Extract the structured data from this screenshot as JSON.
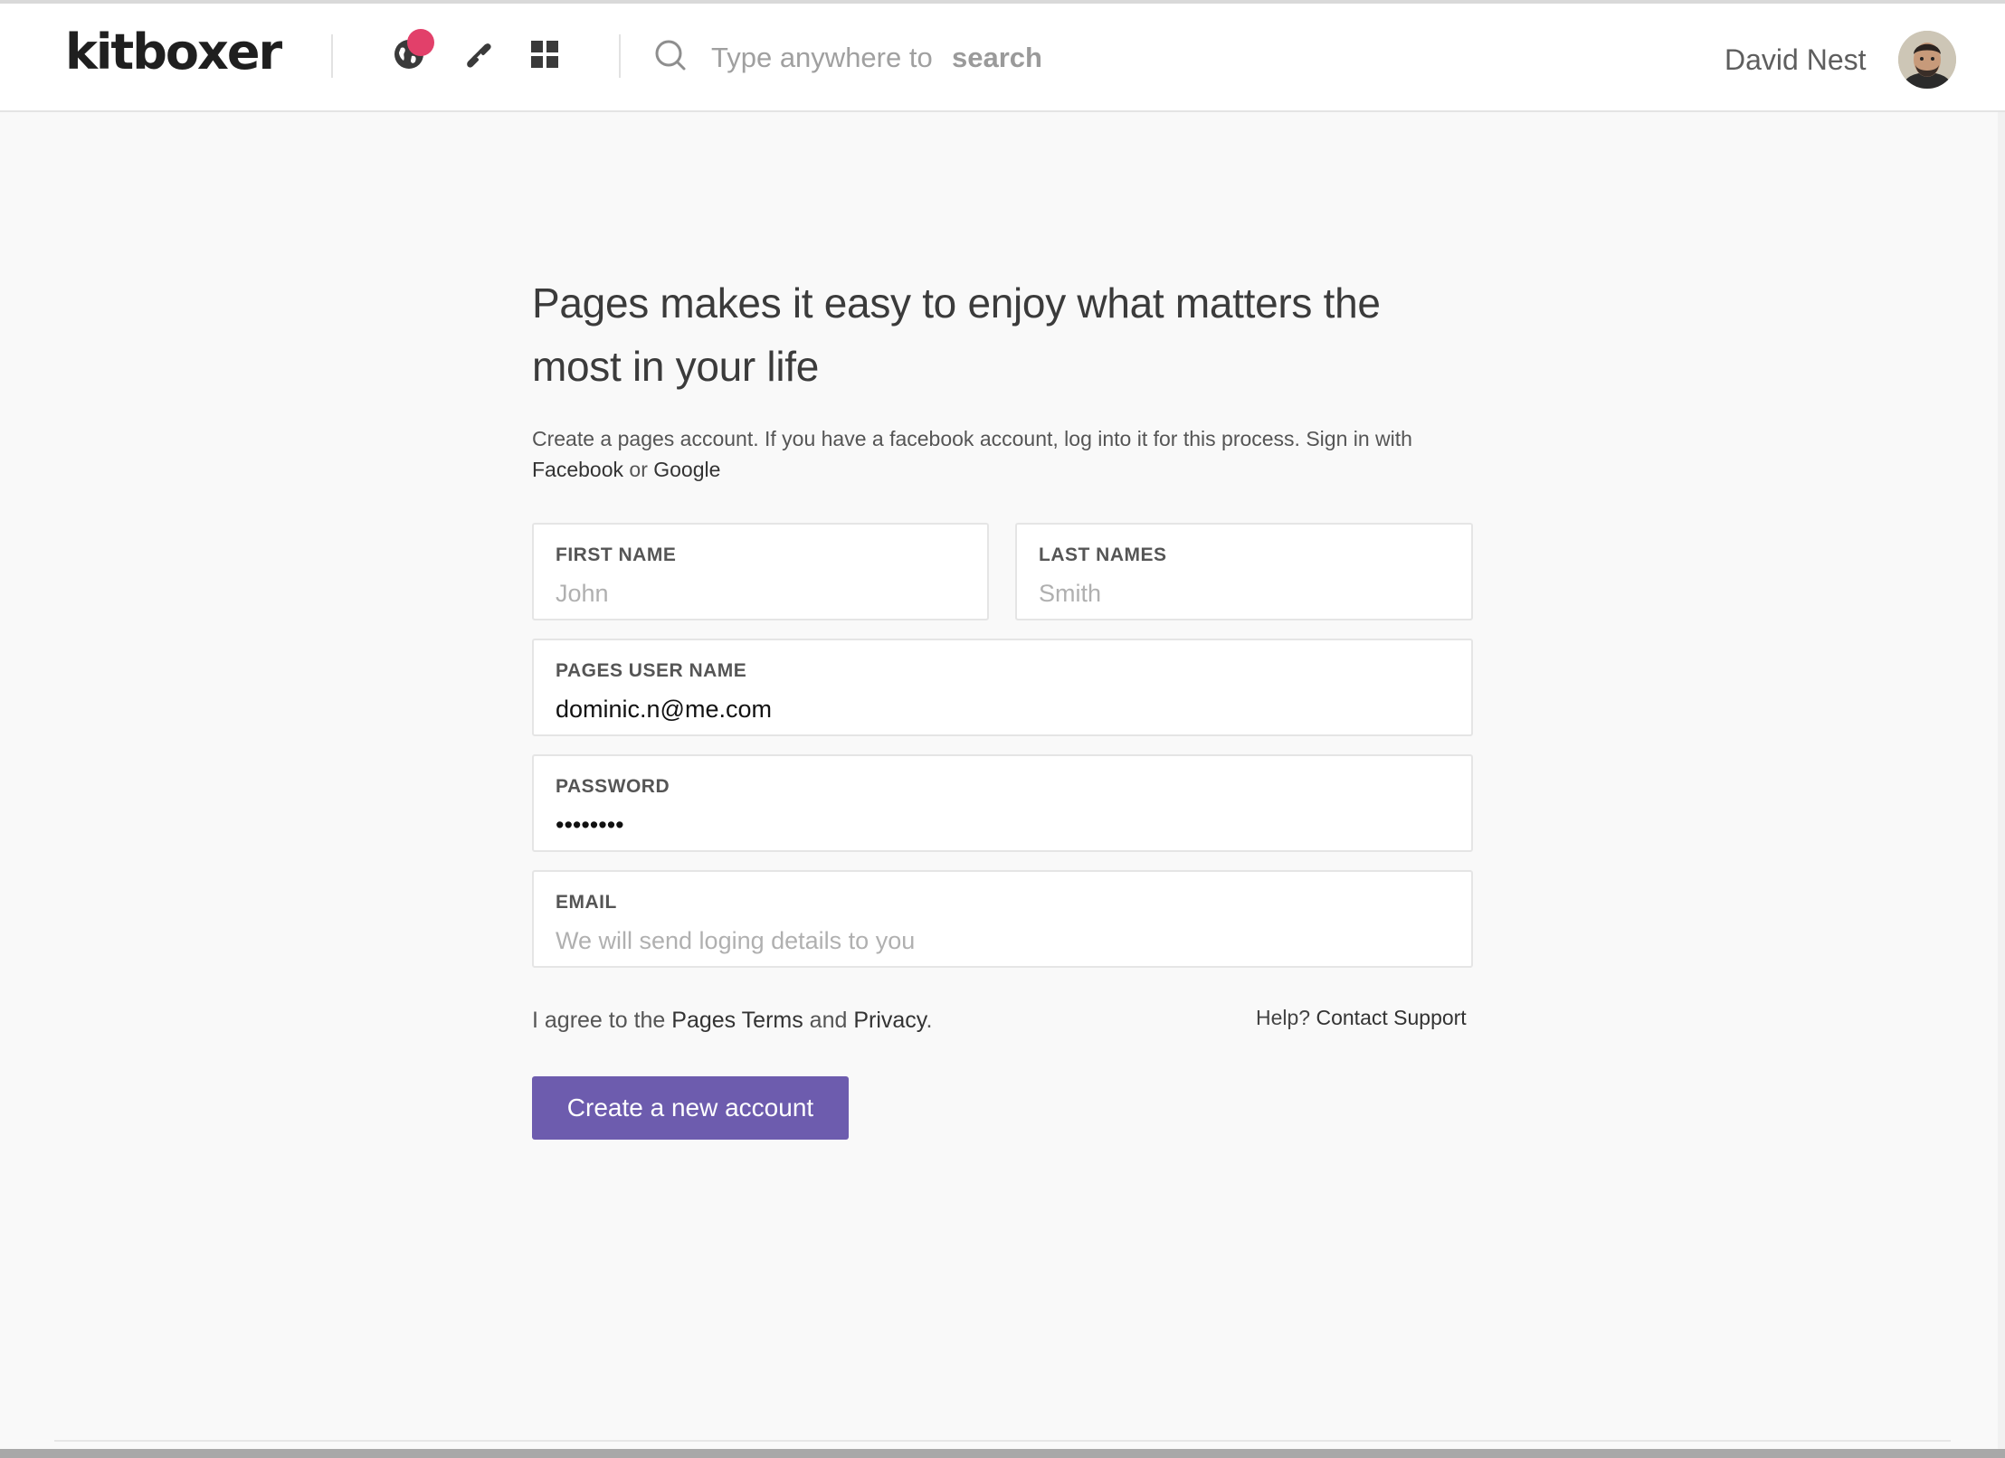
{
  "header": {
    "logo": "kitboxer",
    "search_placeholder": "Type anywhere to ",
    "search_bold": "search",
    "user_name": "David Nest",
    "icons": [
      "globe-icon",
      "link-icon",
      "grid-icon",
      "search-icon"
    ],
    "notification_color": "#e2406a"
  },
  "main": {
    "headline": "Pages makes it easy to enjoy what matters the most in your life",
    "intro": "Create a pages account. If you have a facebook account, log into it for this process. Sign in with ",
    "facebook_link": "Facebook",
    "or_text": " or ",
    "google_link": "Google"
  },
  "form": {
    "first_name": {
      "label": "FIRST NAME",
      "placeholder": "John",
      "value": ""
    },
    "last_name": {
      "label": "LAST NAMES",
      "placeholder": "Smith",
      "value": ""
    },
    "username": {
      "label": "PAGES USER NAME",
      "placeholder": "",
      "value": "dominic.n@me.com"
    },
    "password": {
      "label": "PASSWORD",
      "placeholder": "",
      "value": "password"
    },
    "email": {
      "label": "EMAIL",
      "placeholder": "We will send loging details to you",
      "value": ""
    }
  },
  "agreement": {
    "prefix": "I agree to the ",
    "terms_link": "Pages Terms",
    "and_text": " and ",
    "privacy_link": "Privacy",
    "suffix": "."
  },
  "help": {
    "prefix": "Help? ",
    "link": "Contact Support"
  },
  "submit_label": "Create a new account",
  "colors": {
    "accent": "#6d5cae",
    "notification": "#e2406a"
  }
}
